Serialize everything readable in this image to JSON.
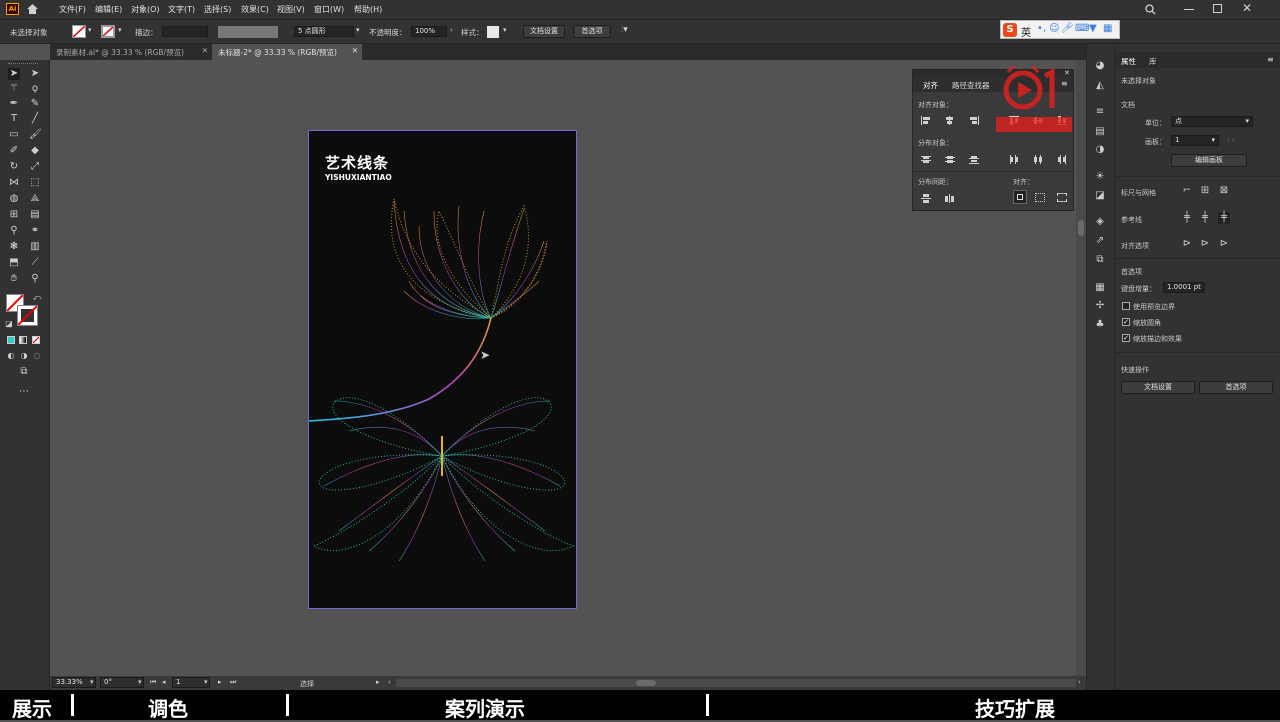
{
  "app": {
    "logo": "Ai"
  },
  "menu": [
    "文件(F)",
    "编辑(E)",
    "对象(O)",
    "文字(T)",
    "选择(S)",
    "效果(C)",
    "视图(V)",
    "窗口(W)",
    "帮助(H)"
  ],
  "control_bar": {
    "selection_status": "未选择对象",
    "stroke_label": "描边：",
    "brush_label": "5 点圆形",
    "opacity_label": "不透明度：",
    "opacity_value": "100%",
    "style_label": "样式：",
    "doc_setup_button": "文档设置",
    "prefs_button": "首选项"
  },
  "doc_tabs": [
    {
      "label": "录制素材.ai* @ 33.33 % (RGB/预览)",
      "active": false
    },
    {
      "label": "未标题-2* @ 33.33 % (RGB/预览)",
      "active": true
    }
  ],
  "artboard": {
    "title": "艺术线条",
    "subtitle": "YISHUXIANTIAO"
  },
  "align_panel": {
    "tabs": [
      "对齐",
      "路径查找器"
    ],
    "align_objects_label": "对齐对象：",
    "distribute_objects_label": "分布对象：",
    "distribute_spacing_label": "分布间距：",
    "align_to_label": "对齐："
  },
  "properties_panel": {
    "tabs": [
      "属性",
      "库"
    ],
    "no_selection": "未选择对象",
    "document_section": "文档",
    "units_label": "单位：",
    "units_value": "点",
    "artboard_label": "画板：",
    "artboard_value": "1",
    "edit_artboards_button": "编辑画板",
    "rulers_grid_label": "标尺与网格",
    "guides_label": "参考线",
    "snap_options_label": "对齐选项",
    "preferences_section": "首选项",
    "keyboard_increment_label": "键盘增量：",
    "keyboard_increment_value": "1.0001 pt",
    "use_preview_bounds": "使用预览边界",
    "scale_corners": "缩放圆角",
    "scale_strokes_effects": "缩放描边和效果",
    "quick_actions_section": "快速操作",
    "doc_setup_button": "文档设置",
    "prefs_button": "首选项"
  },
  "status_bar": {
    "zoom": "33.33%",
    "rotation": "0°",
    "artboard_num": "1",
    "tool": "选择"
  },
  "ime": {
    "lang": "英"
  },
  "bottom_nav": [
    "展示",
    "调色",
    "案列演示",
    "技巧扩展"
  ],
  "colors": {
    "accent": "#6b6bd0",
    "chrome": "#323232",
    "canvas": "#535353"
  }
}
